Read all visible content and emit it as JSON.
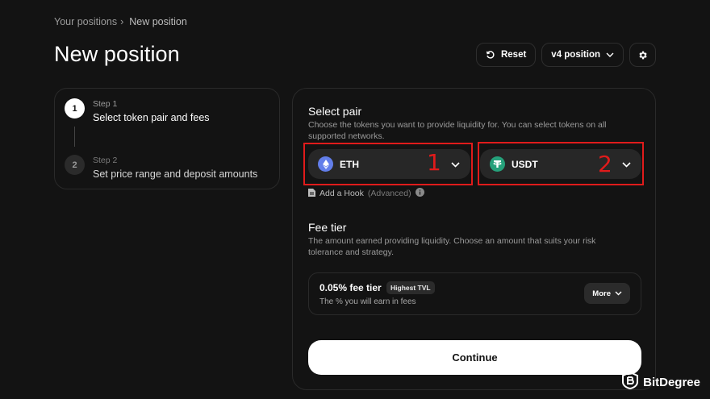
{
  "breadcrumb": {
    "parent": "Your positions",
    "separator": "›",
    "current": "New position"
  },
  "page_title": "New position",
  "top_actions": {
    "reset_label": "Reset",
    "version_label": "v4 position"
  },
  "steps": [
    {
      "number": "1",
      "small": "Step 1",
      "label": "Select token pair and fees"
    },
    {
      "number": "2",
      "small": "Step 2",
      "label": "Set price range and deposit amounts"
    }
  ],
  "select_pair": {
    "title": "Select pair",
    "description": "Choose the tokens you want to provide liquidity for. You can select tokens on all supported networks.",
    "token_a": "ETH",
    "token_b": "USDT",
    "annotation_a": "1",
    "annotation_b": "2",
    "hook_label": "Add a Hook",
    "hook_advanced": "(Advanced)"
  },
  "fee_tier": {
    "title": "Fee tier",
    "description": "The amount earned providing liquidity. Choose an amount that suits your risk tolerance and strategy.",
    "selected": "0.05% fee tier",
    "badge": "Highest TVL",
    "sub": "The % you will earn in fees",
    "more_label": "More"
  },
  "continue_label": "Continue",
  "watermark": "BitDegree",
  "colors": {
    "background": "#131313",
    "annotation": "#e01b1b",
    "eth": "#627eea",
    "usdt": "#26a17b"
  }
}
